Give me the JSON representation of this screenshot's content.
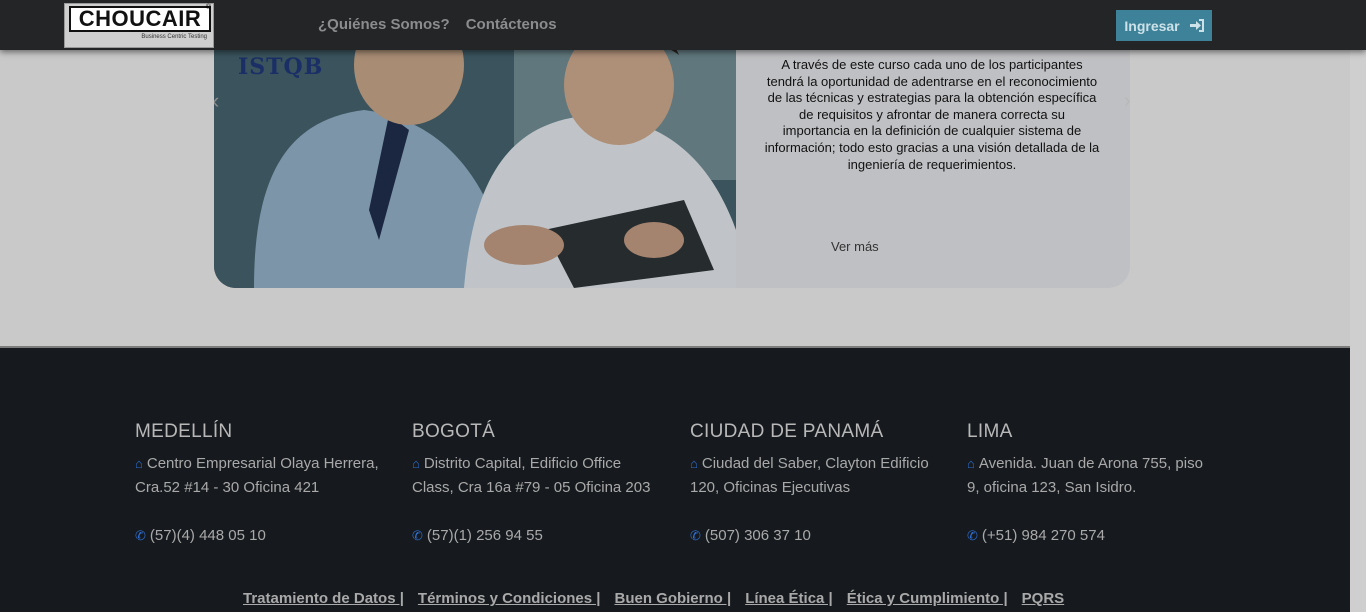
{
  "header": {
    "logo_text": "CHOUCAIR",
    "logo_subtitle": "Business Centric Testing",
    "logo_reg": "®",
    "nav": [
      "¿Quiénes Somos?",
      "Contáctenos"
    ],
    "login_label": "Ingresar",
    "login_icon": "sign-in-icon"
  },
  "course": {
    "image_logo": "ISTQB",
    "description": "A través de este curso cada uno de los participantes tendrá la oportunidad de adentrarse en el reconocimiento de las técnicas y estrategias para la obtención específica de requisitos y afrontar de manera correcta su importancia en la definición de cualquier sistema de información; todo esto gracias a una visión detallada de la ingeniería de requerimientos.",
    "more_label": "Ver más",
    "prev_icon": "chevron-left-icon",
    "next_icon": "chevron-right-icon"
  },
  "footer": {
    "offices": [
      {
        "city": "MEDELLÍN",
        "address": "Centro Empresarial Olaya Herrera, Cra.52 #14 - 30 Oficina 421",
        "phone": "(57)(4) 448 05 10"
      },
      {
        "city": "BOGOTÁ",
        "address": "Distrito Capital, Edificio Office Class, Cra 16a #79 - 05 Oficina 203",
        "phone": "(57)(1) 256 94 55"
      },
      {
        "city": "CIUDAD DE PANAMÁ",
        "address": "Ciudad del Saber, Clayton Edificio 120, Oficinas Ejecutivas",
        "phone": "(507) 306 37 10"
      },
      {
        "city": "LIMA",
        "address": "Avenida. Juan de Arona 755, piso 9, oficina 123, San Isidro.",
        "phone": "(+51) 984 270 574"
      }
    ],
    "links": [
      "Tratamiento de Datos |",
      "Términos y Condiciones |",
      "Buen Gobierno |",
      "Línea Ética |",
      "Ética y Cumplimiento |",
      "PQRS"
    ],
    "address_icon": "home-icon",
    "phone_icon": "phone-icon",
    "icon_color": "#2f6fd1"
  },
  "colors": {
    "header_bg": "#232527",
    "button_bg": "#3d8298",
    "footer_bg": "#161a1e",
    "page_bg": "#c9c9c9"
  }
}
